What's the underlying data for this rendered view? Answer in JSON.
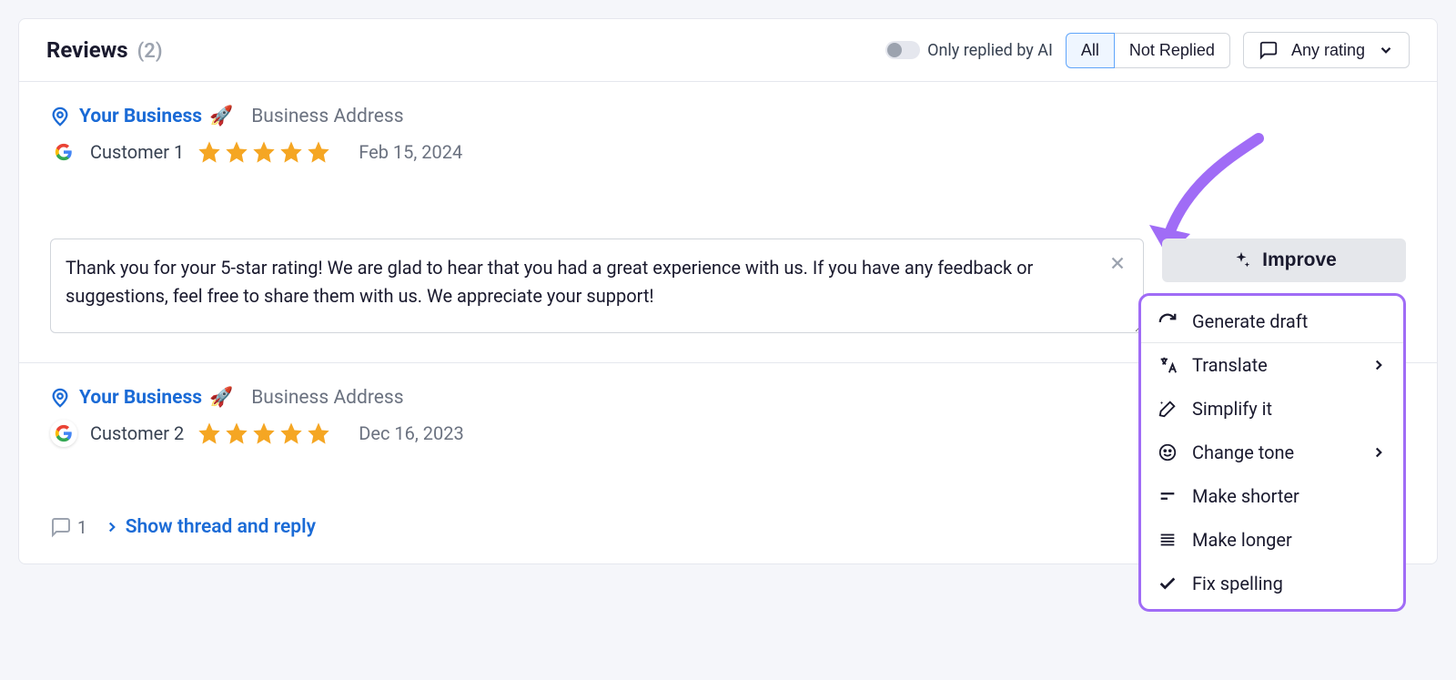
{
  "header": {
    "title": "Reviews",
    "count": "(2)",
    "toggle_label": "Only replied by AI",
    "tabs": {
      "all": "All",
      "not_replied": "Not Replied"
    },
    "rating_label": "Any rating"
  },
  "reviews": [
    {
      "business": "Your Business",
      "address": "Business Address",
      "customer": "Customer 1",
      "rating": 5,
      "date": "Feb 15, 2024",
      "reply_text": "Thank you for your 5-star rating! We are glad to hear that you had a great experience with us. If you have any feedback or suggestions, feel free to share them with us. We appreciate your support!",
      "improve_label": "Improve"
    },
    {
      "business": "Your Business",
      "address": "Business Address",
      "customer": "Customer 2",
      "rating": 5,
      "date": "Dec 16, 2023",
      "thread_count": "1",
      "show_thread": "Show thread and reply"
    }
  ],
  "improve_menu": {
    "generate": "Generate draft",
    "translate": "Translate",
    "simplify": "Simplify it",
    "tone": "Change tone",
    "shorter": "Make shorter",
    "longer": "Make longer",
    "fix": "Fix spelling"
  }
}
